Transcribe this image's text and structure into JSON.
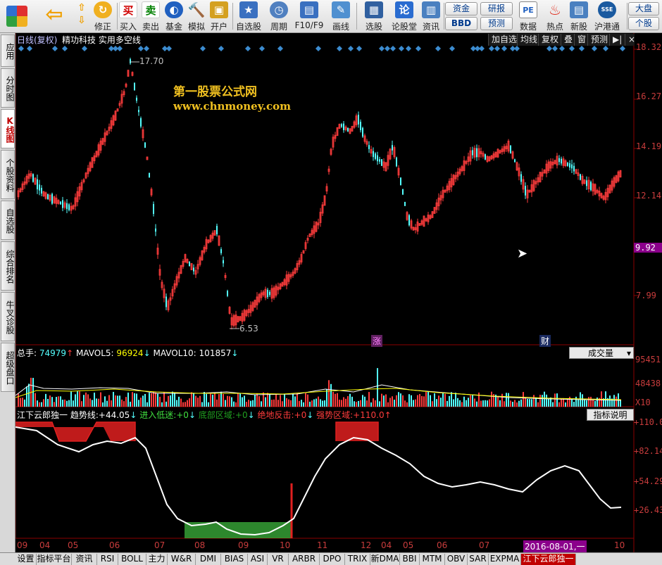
{
  "toolbar": {
    "items": [
      {
        "label": "",
        "icon": "app-logo-icon"
      },
      {
        "label": "",
        "icon": "back-arrow-icon"
      },
      {
        "label": "修正",
        "icon": "refresh-icon"
      },
      {
        "label": "买入",
        "icon_text": "买"
      },
      {
        "label": "卖出",
        "icon_text": "卖"
      },
      {
        "label": "基金",
        "icon": "fund-icon"
      },
      {
        "label": "模拟",
        "icon": "hammer-icon"
      },
      {
        "label": "开户",
        "icon": "lock-icon"
      },
      {
        "label": "自选股",
        "icon": "star-folder-icon"
      },
      {
        "label": "周期",
        "icon": "clock-icon"
      },
      {
        "label": "F10/F9",
        "icon": "document-icon"
      },
      {
        "label": "画线",
        "icon": "pen-icon"
      },
      {
        "label": "选股",
        "icon": "screen-icon"
      },
      {
        "label": "论股堂",
        "icon_text": "论"
      },
      {
        "label": "资讯",
        "icon": "news-icon"
      }
    ],
    "mini": {
      "zijin": "资金",
      "bbd": "BBD",
      "yanbao": "研报",
      "yuce": "预测",
      "pe": "PE",
      "shuju": "数据",
      "redian": "热点",
      "xingu": "新股",
      "hugangtong": "沪港通",
      "dapan": "大盘",
      "gegu": "个股"
    }
  },
  "left_tabs": [
    "应用",
    "分时图",
    "K线图",
    "个股资料",
    "自选股",
    "综合排名",
    "牛叉诊股",
    "超级盘口"
  ],
  "chart": {
    "header_left": "日线(复权)",
    "header_title": "精功科技 实用多空线",
    "top_buttons": [
      "加自选",
      "均线",
      "复权",
      "叠",
      "窗",
      "预测"
    ],
    "price_axis": [
      "18.32",
      "16.27",
      "14.19",
      "12.14",
      "9.92",
      "7.99"
    ],
    "current_price_tag": "9.92",
    "high_label": "17.70",
    "low_label": "6.53",
    "event_marks": [
      "涨",
      "财"
    ],
    "watermark_cn": "第一股票公式网",
    "watermark_url": "www.chnmoney.com"
  },
  "volume": {
    "total_label": "总手:",
    "total_value": "74979",
    "ma5_label": "MAVOL5:",
    "ma5_value": "96924",
    "ma10_label": "MAVOL10:",
    "ma10_value": "101857",
    "selector": "成交量",
    "axis": [
      "95451",
      "48438",
      "X10"
    ]
  },
  "indicator": {
    "name": "江下云郎独一",
    "trend_label": "趋势线:",
    "trend_value": "+44.05",
    "entry_label": "进入低迷:",
    "entry_value": "+0",
    "bottom_label": "底部区域:",
    "bottom_value": "+0",
    "rebound_label": "绝地反击:",
    "rebound_value": "+0",
    "strong_label": "强势区域:",
    "strong_value": "+110.0",
    "explain_button": "指标说明",
    "axis": [
      "+110.0",
      "+82.14",
      "+54.29",
      "+26.43"
    ]
  },
  "date_axis": [
    "09",
    "04",
    "05",
    "06",
    "07",
    "08",
    "09",
    "10",
    "11",
    "12",
    "04",
    "05",
    "06",
    "07",
    "2016-08-01,一",
    "10"
  ],
  "bottom_tabs": [
    "设置",
    "指标平台",
    "资讯",
    "RSI",
    "BOLL",
    "主力",
    "W&R",
    "DMI",
    "BIAS",
    "ASI",
    "VR",
    "ARBR",
    "DPO",
    "TRIX",
    "新DMA",
    "BBI",
    "MTM",
    "OBV",
    "SAR",
    "EXPMA",
    "江下云郎独一"
  ],
  "colors": {
    "up": "#ff3c3c",
    "down": "#54ffff",
    "axis": "#8b0000",
    "trend_line": "#ffffff",
    "strong_zone": "#e02020",
    "bottom_zone": "#40c040",
    "diamond": "#3c8cd0"
  }
}
